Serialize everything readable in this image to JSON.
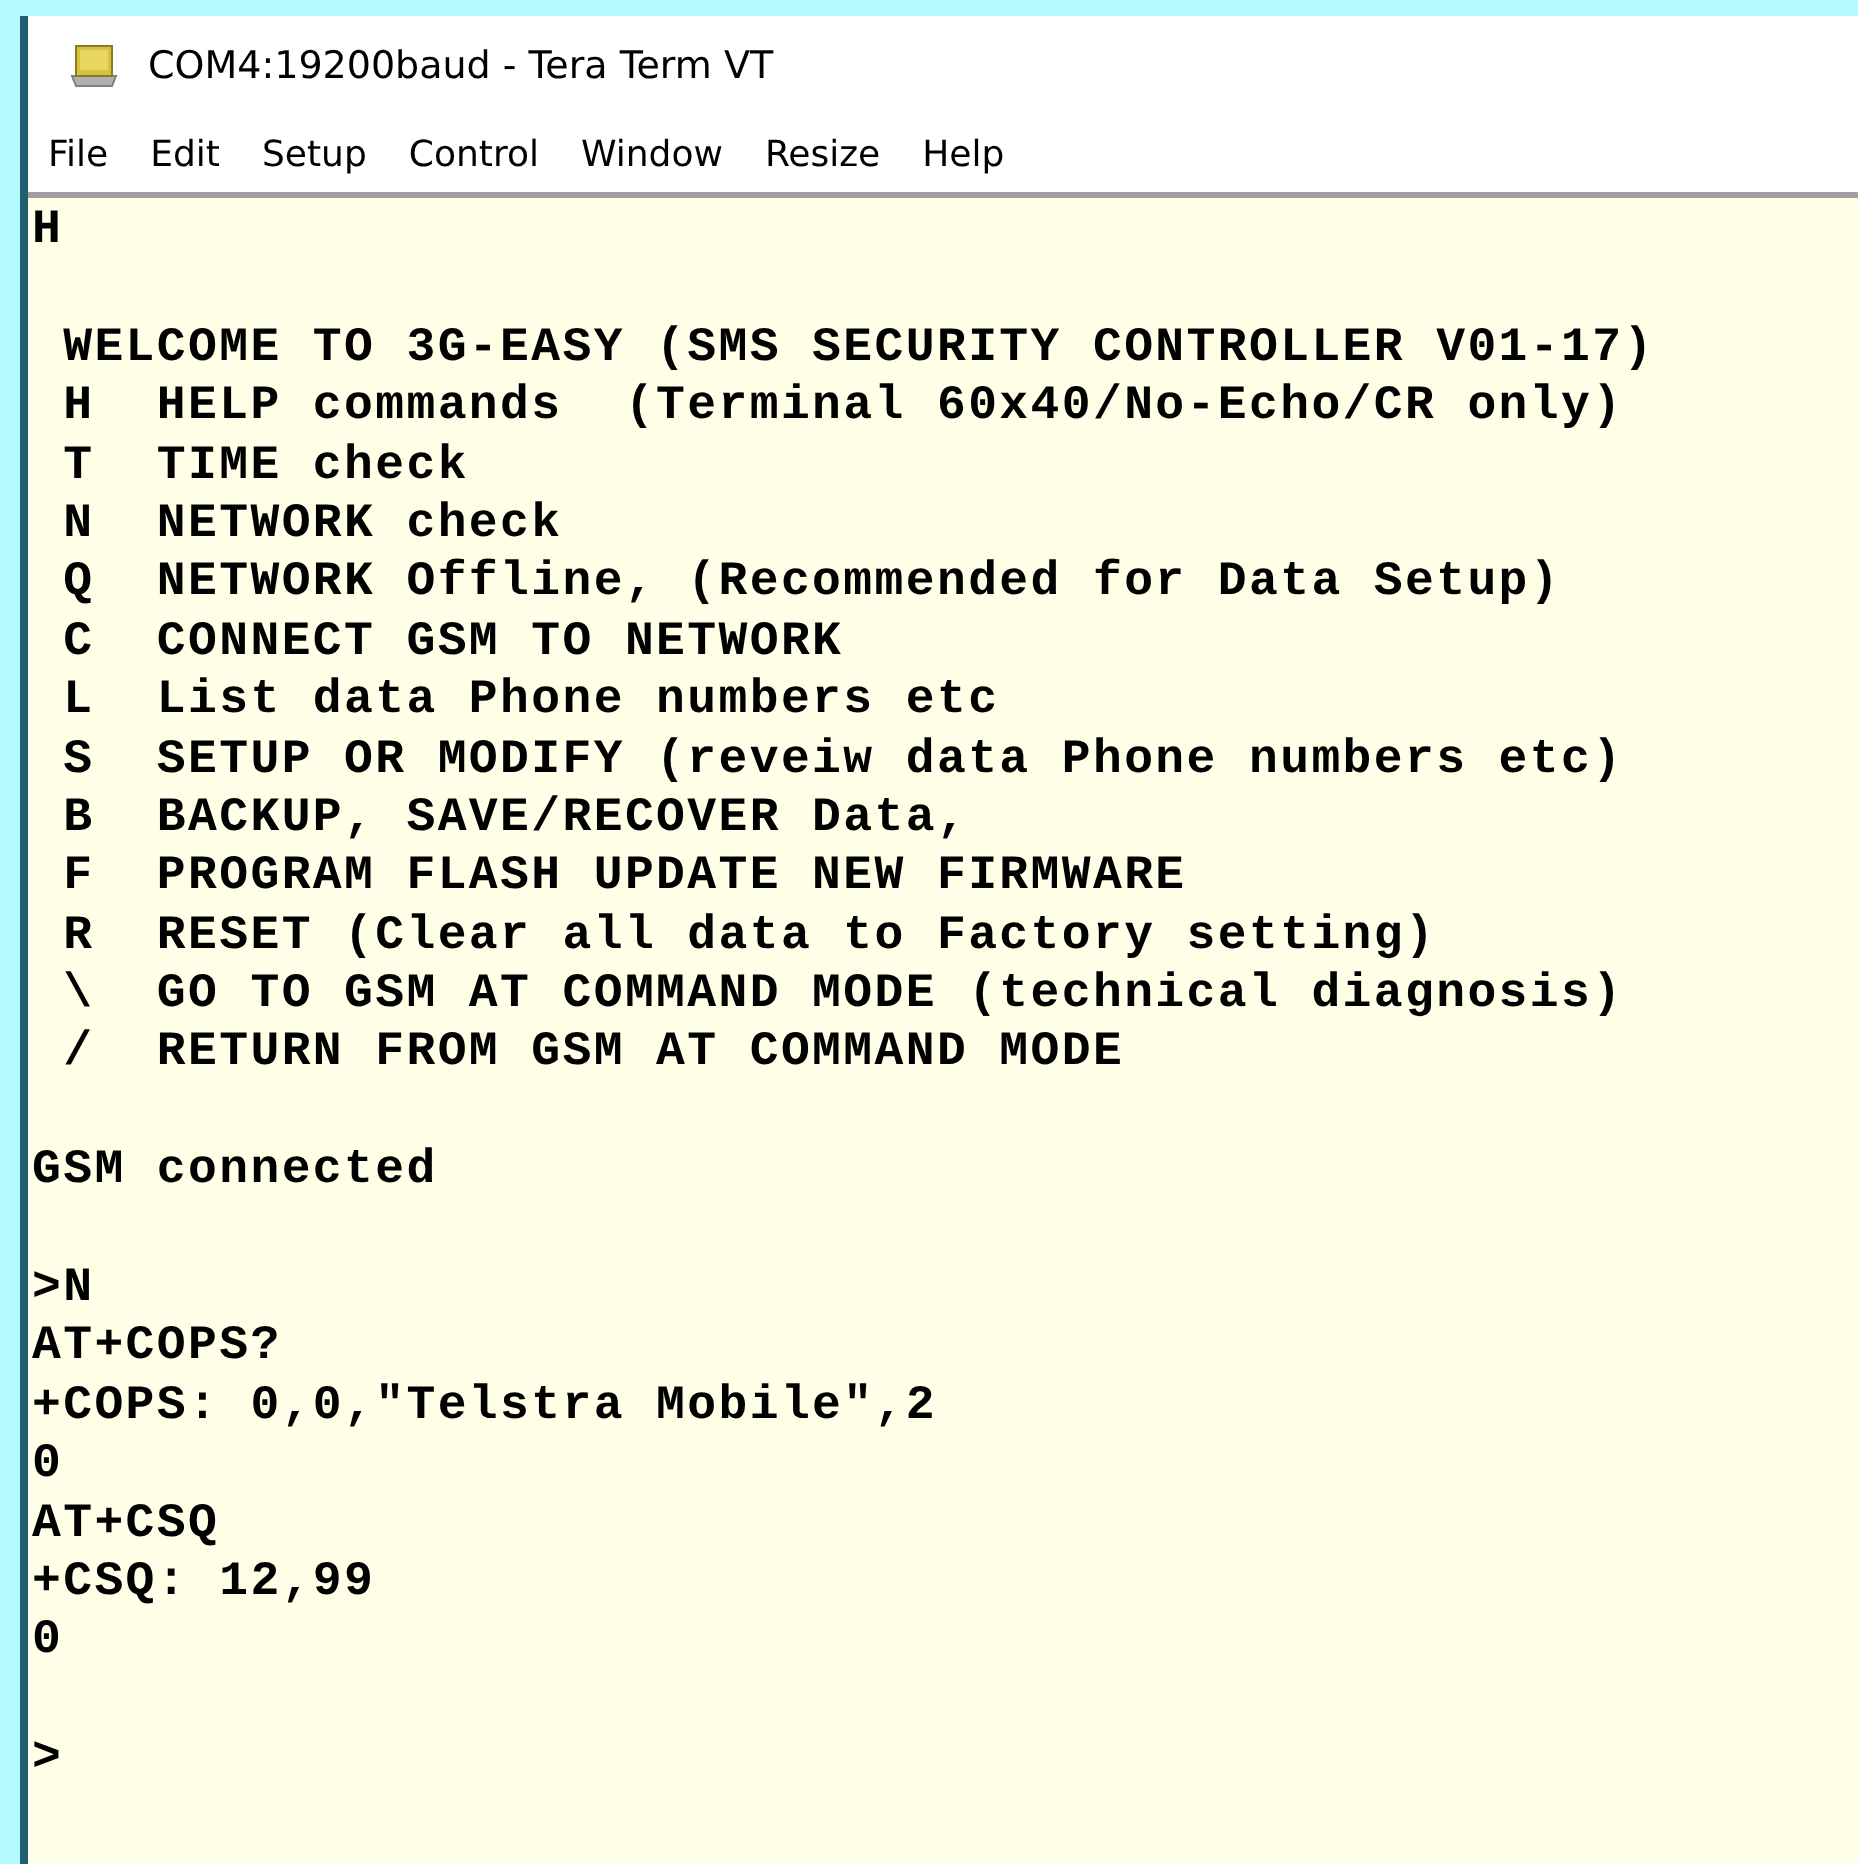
{
  "window": {
    "title": "COM4:19200baud - Tera Term VT"
  },
  "menu": [
    "File",
    "Edit",
    "Setup",
    "Control",
    "Window",
    "Resize",
    "Help"
  ],
  "terminal": {
    "blocks": [
      [
        "H"
      ],
      [
        " WELCOME TO 3G-EASY (SMS SECURITY CONTROLLER V01-17)",
        " H  HELP commands  (Terminal 60x40/No-Echo/CR only)",
        " T  TIME check",
        " N  NETWORK check",
        " Q  NETWORK Offline, (Recommended for Data Setup)",
        " C  CONNECT GSM TO NETWORK",
        " L  List data Phone numbers etc",
        " S  SETUP OR MODIFY (reveiw data Phone numbers etc)",
        " B  BACKUP, SAVE/RECOVER Data,",
        " F  PROGRAM FLASH UPDATE NEW FIRMWARE",
        " R  RESET (Clear all data to Factory setting)",
        " \\  GO TO GSM AT COMMAND MODE (technical diagnosis)",
        " /  RETURN FROM GSM AT COMMAND MODE"
      ],
      [
        "GSM connected"
      ],
      [
        ">N",
        "AT+COPS?",
        "+COPS: 0,0,\"Telstra Mobile\",2",
        "0",
        "AT+CSQ",
        "+CSQ: 12,99",
        "0"
      ],
      [
        ">"
      ]
    ]
  }
}
